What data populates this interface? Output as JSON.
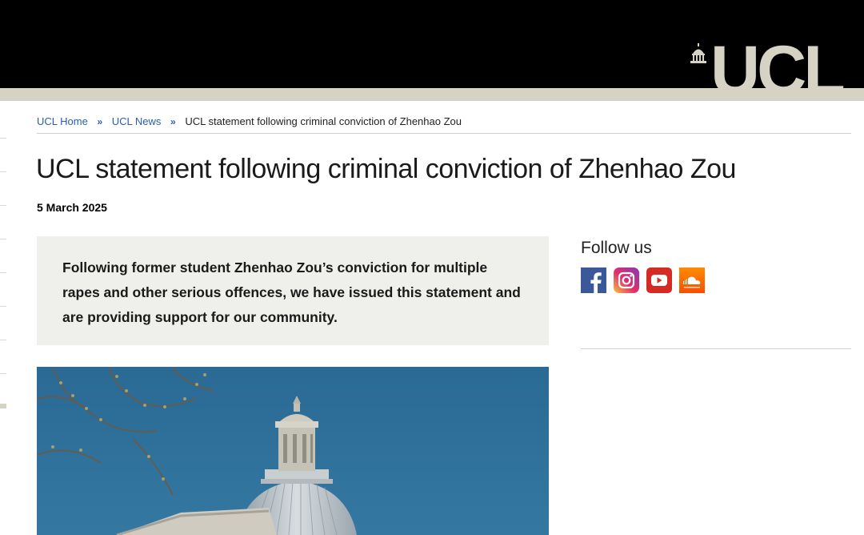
{
  "header": {
    "logo_text": "UCL",
    "brand_colors": {
      "black": "#000000",
      "stone": "#d6d2c4"
    }
  },
  "breadcrumb": {
    "items": [
      "UCL Home",
      "UCL News"
    ],
    "separator": "»",
    "current": "UCL statement following criminal conviction of Zhenhao Zou"
  },
  "article": {
    "title": "UCL statement following criminal conviction of Zhenhao Zou",
    "date": "5 March 2025",
    "lead": "Following former student Zhenhao Zou’s conviction for multiple rapes and other serious offences, we have issued this statement and are providing support for our community.",
    "hero_image": "ucl-portico-dome-photo"
  },
  "sidebar": {
    "follow_title": "Follow us",
    "social_icons": [
      "facebook-icon",
      "instagram-icon",
      "youtube-icon",
      "soundcloud-icon"
    ]
  }
}
